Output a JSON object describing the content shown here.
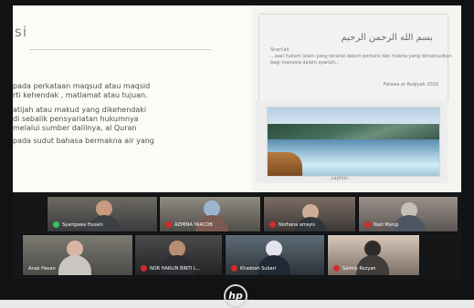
{
  "slide": {
    "title": "si",
    "paragraphs": [
      "pada perkataan maqsud atau maqsid",
      "rti kehendak , matlamat atau tujuan.",
      "atijah atau makud yang dikehendaki",
      "di sebalik pensyariatan hukumnya",
      "melalui  sumber dalilnya, al Quran",
      "pada sudut bahasa bermakna air yang"
    ],
    "arabic_text": "بسم الله الرحمن الرحيم",
    "small_lines": [
      "Shariʿah",
      "...asal hukum Islam yang tersirat dalam perkara dan makna yang dimaksudkan",
      "bagi manusia dalam syariah..."
    ],
    "small_right": "Fatawa ar-Ruqiyah 2020",
    "photo_caption": "...caption..."
  },
  "participants": [
    {
      "name": "Syarigawa Husain",
      "mic": "green"
    },
    {
      "name": "AZMINA YAACOB",
      "mic": "red"
    },
    {
      "name": "Norhana arrayis",
      "mic": "red"
    },
    {
      "name": "Nazi Mangi",
      "mic": "red"
    },
    {
      "name": "Anak Hasan",
      "mic": "red"
    },
    {
      "name": "NOR HARLIN BINTI L...",
      "mic": "red"
    },
    {
      "name": "Khadzah Subari",
      "mic": "red"
    },
    {
      "name": "Salmiy Rozyan",
      "mic": "red"
    }
  ],
  "brand": "hp"
}
